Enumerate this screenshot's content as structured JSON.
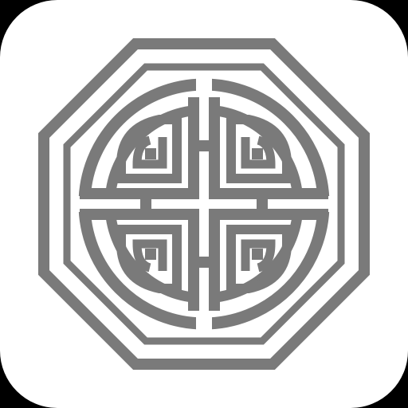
{
  "icon": {
    "name": "octagonal-longevity-knot-emblem",
    "tile_color": "#ffffff",
    "background_color": "#000000",
    "pattern_color": "#7a7a7a"
  }
}
